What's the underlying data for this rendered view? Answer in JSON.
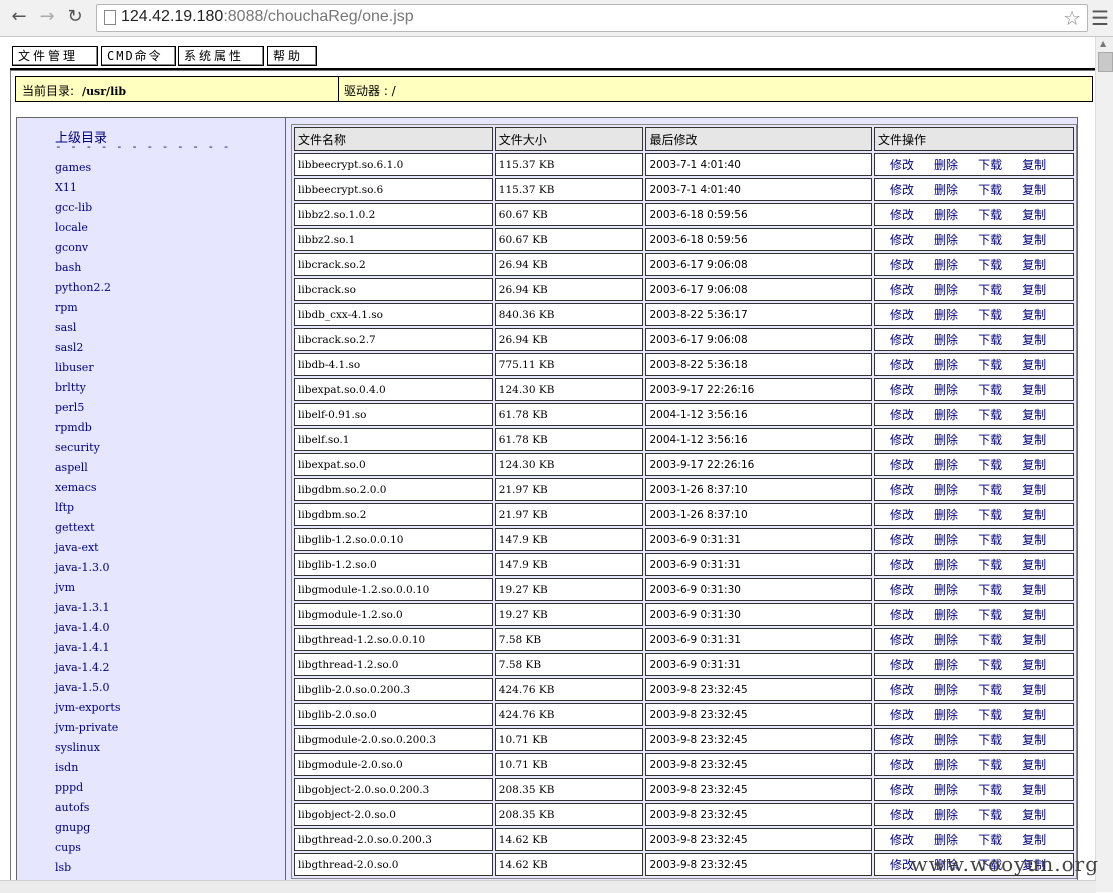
{
  "browser": {
    "back_icon": "arrow-left-icon",
    "forward_icon": "arrow-right-icon",
    "reload_icon": "reload-icon",
    "url_host": "124.42.19.180",
    "url_rest": ":8088/chouchaReg/one.jsp",
    "star_icon": "star-icon",
    "menu_icon": "hamburger-icon"
  },
  "tabs": [
    "文件管理",
    "CMD命令",
    "系统属性",
    "帮助"
  ],
  "info": {
    "current_dir_label": "当前目录:",
    "current_dir_value": "/usr/lib",
    "drive_label": "驱动器 : /"
  },
  "sidebar": {
    "parent_label": "上级目录",
    "dashes": "- - - - - - - - - - - -",
    "dirs": [
      "games",
      "X11",
      "gcc-lib",
      "locale",
      "gconv",
      "bash",
      "python2.2",
      "rpm",
      "sasl",
      "sasl2",
      "libuser",
      "brltty",
      "perl5",
      "rpmdb",
      "security",
      "aspell",
      "xemacs",
      "lftp",
      "gettext",
      "java-ext",
      "java-1.3.0",
      "jvm",
      "java-1.3.1",
      "java-1.4.0",
      "java-1.4.1",
      "java-1.4.2",
      "java-1.5.0",
      "jvm-exports",
      "jvm-private",
      "syslinux",
      "isdn",
      "pppd",
      "autofs",
      "gnupg",
      "cups",
      "lsb"
    ]
  },
  "table": {
    "headers": [
      "文件名称",
      "文件大小",
      "最后修改",
      "文件操作"
    ],
    "ops": [
      "修改",
      "删除",
      "下载",
      "复制"
    ],
    "rows": [
      [
        "libbeecrypt.so.6.1.0",
        "115.37 KB",
        "2003-7-1 4:01:40"
      ],
      [
        "libbeecrypt.so.6",
        "115.37 KB",
        "2003-7-1 4:01:40"
      ],
      [
        "libbz2.so.1.0.2",
        "60.67 KB",
        "2003-6-18 0:59:56"
      ],
      [
        "libbz2.so.1",
        "60.67 KB",
        "2003-6-18 0:59:56"
      ],
      [
        "libcrack.so.2",
        "26.94 KB",
        "2003-6-17 9:06:08"
      ],
      [
        "libcrack.so",
        "26.94 KB",
        "2003-6-17 9:06:08"
      ],
      [
        "libdb_cxx-4.1.so",
        "840.36 KB",
        "2003-8-22 5:36:17"
      ],
      [
        "libcrack.so.2.7",
        "26.94 KB",
        "2003-6-17 9:06:08"
      ],
      [
        "libdb-4.1.so",
        "775.11 KB",
        "2003-8-22 5:36:18"
      ],
      [
        "libexpat.so.0.4.0",
        "124.30 KB",
        "2003-9-17 22:26:16"
      ],
      [
        "libelf-0.91.so",
        "61.78 KB",
        "2004-1-12 3:56:16"
      ],
      [
        "libelf.so.1",
        "61.78 KB",
        "2004-1-12 3:56:16"
      ],
      [
        "libexpat.so.0",
        "124.30 KB",
        "2003-9-17 22:26:16"
      ],
      [
        "libgdbm.so.2.0.0",
        "21.97 KB",
        "2003-1-26 8:37:10"
      ],
      [
        "libgdbm.so.2",
        "21.97 KB",
        "2003-1-26 8:37:10"
      ],
      [
        "libglib-1.2.so.0.0.10",
        "147.9 KB",
        "2003-6-9 0:31:31"
      ],
      [
        "libglib-1.2.so.0",
        "147.9 KB",
        "2003-6-9 0:31:31"
      ],
      [
        "libgmodule-1.2.so.0.0.10",
        "19.27 KB",
        "2003-6-9 0:31:30"
      ],
      [
        "libgmodule-1.2.so.0",
        "19.27 KB",
        "2003-6-9 0:31:30"
      ],
      [
        "libgthread-1.2.so.0.0.10",
        "7.58 KB",
        "2003-6-9 0:31:31"
      ],
      [
        "libgthread-1.2.so.0",
        "7.58 KB",
        "2003-6-9 0:31:31"
      ],
      [
        "libglib-2.0.so.0.200.3",
        "424.76 KB",
        "2003-9-8 23:32:45"
      ],
      [
        "libglib-2.0.so.0",
        "424.76 KB",
        "2003-9-8 23:32:45"
      ],
      [
        "libgmodule-2.0.so.0.200.3",
        "10.71 KB",
        "2003-9-8 23:32:45"
      ],
      [
        "libgmodule-2.0.so.0",
        "10.71 KB",
        "2003-9-8 23:32:45"
      ],
      [
        "libgobject-2.0.so.0.200.3",
        "208.35 KB",
        "2003-9-8 23:32:45"
      ],
      [
        "libgobject-2.0.so.0",
        "208.35 KB",
        "2003-9-8 23:32:45"
      ],
      [
        "libgthread-2.0.so.0.200.3",
        "14.62 KB",
        "2003-9-8 23:32:45"
      ],
      [
        "libgthread-2.0.so.0",
        "14.62 KB",
        "2003-9-8 23:32:45"
      ]
    ]
  },
  "watermark": "www.wooyun.org"
}
